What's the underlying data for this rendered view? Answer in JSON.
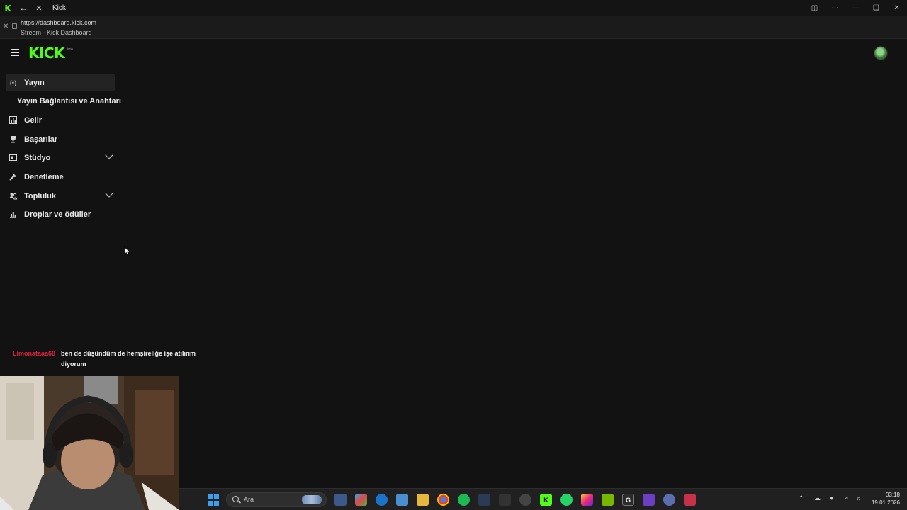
{
  "browser": {
    "tab_title": "Kick",
    "url": "https://dashboard.kick.com",
    "page_title": "Stream - Kick Dashboard"
  },
  "app": {
    "logo": "KICK",
    "logo_badge": "beta",
    "accent_color": "#53fc18"
  },
  "sidebar": {
    "items": [
      {
        "label": "Yayın",
        "icon": "broadcast-icon"
      },
      {
        "label": "Yayın Bağlantısı ve Anahtarı"
      },
      {
        "label": "Gelir",
        "icon": "chart-icon"
      },
      {
        "label": "Başarılar",
        "icon": "trophy-icon"
      },
      {
        "label": "Stüdyo",
        "icon": "studio-icon"
      },
      {
        "label": "Denetleme",
        "icon": "wrench-icon"
      },
      {
        "label": "Topluluk",
        "icon": "community-icon"
      },
      {
        "label": "Droplar ve ödüller",
        "icon": "gift-icon"
      }
    ]
  },
  "chat": {
    "username": "Limonataaa68",
    "message": "ben de düşündüm de hemşireliğe işe atılırım diyorum",
    "username_color": "#e0213b"
  },
  "taskbar": {
    "search_placeholder": "Ara",
    "time": "03:18",
    "date": "19.01.2026"
  }
}
